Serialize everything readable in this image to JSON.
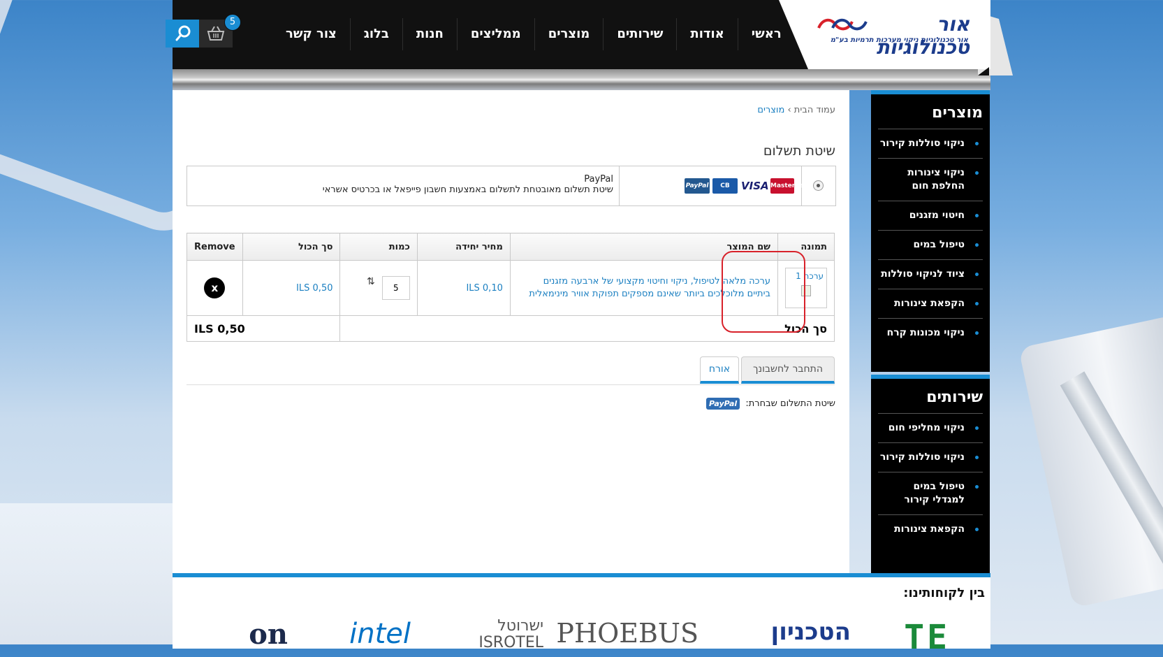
{
  "header": {
    "logo_title": "אור טכנולוגיות",
    "logo_subtitle": "אור טכנולוגיות ניקוי מערכות תרמיות בע\"מ",
    "nav": [
      "ראשי",
      "אודות",
      "שירותים",
      "מוצרים",
      "ממליצים",
      "חנות",
      "בלוג",
      "צור קשר"
    ],
    "cart_count": "5"
  },
  "breadcrumb": {
    "home": "עמוד הבית",
    "separator": "›",
    "current": "מוצרים"
  },
  "payment": {
    "title": "שיטת תשלום",
    "method_name": "PayPal",
    "method_desc": "שיטת תשלום מאובטחת לתשלום באמצעות חשבון פייפאל או בכרטיס אשראי",
    "cards": [
      "MasterCard",
      "VISA",
      "CB",
      "PayPal"
    ]
  },
  "cart": {
    "headers": {
      "image": "תמונה",
      "name": "שם המוצר",
      "unit_price": "מחיר יחידה",
      "quantity": "כמות",
      "total": "סך הכול",
      "remove": "Remove"
    },
    "item": {
      "thumb_label": "ערכה 1",
      "name": "ערכה מלאה לטיפול, ניקוי וחיטוי מקצועי של ארבעה מזגנים ביתיים מלוכלכים ביותר שאינם מספקים תפוקת אוויר מינימאלית",
      "unit_price": "ILS 0,10",
      "quantity": "5",
      "total": "ILS 0,50",
      "remove_label": "x"
    },
    "grand_total_label": "סך הכול",
    "grand_total": "ILS 0,50"
  },
  "tabs": {
    "login": "התחבר לחשבונך",
    "guest": "אורח"
  },
  "chosen_payment": {
    "label": "שיטת התשלום שבחרת:",
    "badge": "PayPal"
  },
  "sidebar_products": {
    "title": "מוצרים",
    "items": [
      "ניקוי סוללות קירור",
      "ניקוי צינורות החלפת חום",
      "חיטוי מזגנים",
      "טיפול במים",
      "ציוד לניקוי סוללות",
      "הקפאת צינורות",
      "ניקוי מכונות קרח"
    ]
  },
  "sidebar_services": {
    "title": "שירותים",
    "items": [
      "ניקוי מחליפי חום",
      "ניקוי סוללות קירור",
      "טיפול במים למגדלי קירור",
      "הקפאת צינורות"
    ]
  },
  "footer": {
    "title": "בין לקוחותינו:",
    "clients": [
      "TE",
      "הטכניון",
      "PHOEBUS",
      "ישרוטל ISROTEL",
      "intel",
      "on"
    ]
  },
  "colors": {
    "accent": "#1a8dd3",
    "link": "#1a7fc1",
    "highlight": "#d8212a"
  }
}
